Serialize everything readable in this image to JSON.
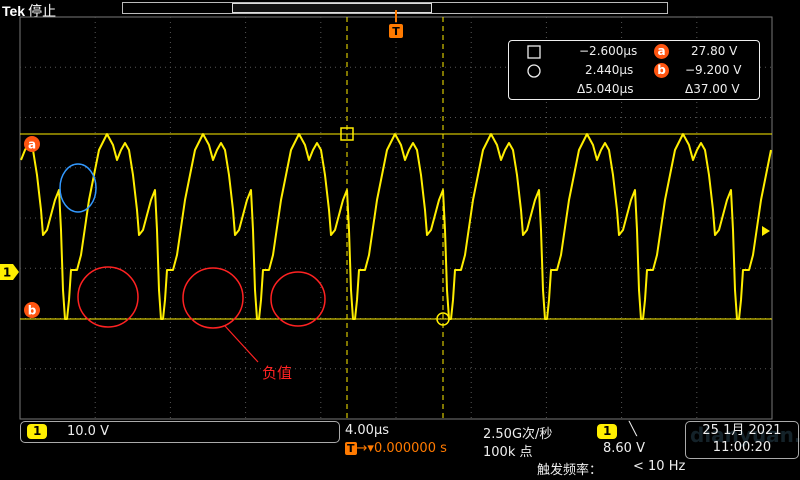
{
  "header": {
    "brand": "Tek",
    "state": "停止"
  },
  "trigger_marker": "T",
  "cursor_readout": {
    "cursor_a_time": "−2.600µs",
    "cursor_a_label": "a",
    "cursor_a_value": "27.80 V",
    "cursor_b_time": "2.440µs",
    "cursor_b_label": "b",
    "cursor_b_value": "−9.200 V",
    "delta_time": "Δ5.040µs",
    "delta_value": "Δ37.00 V"
  },
  "side_marks": {
    "cursor_a": "a",
    "cursor_b": "b",
    "channel": "1"
  },
  "annotation": {
    "text": "负值"
  },
  "channel_panel": {
    "channel": "1",
    "scale": "10.0 V"
  },
  "acquisition": {
    "timebase": "4.00µs",
    "sample_rate": "2.50G次/秒",
    "trigger_position": "0.000000 s",
    "record_length": "100k 点",
    "trigger_channel": "1",
    "trigger_slope": "╲",
    "trigger_level": "8.60 V",
    "trigger_freq_label": "触发频率：",
    "trigger_freq_value": "< 10 Hz"
  },
  "datetime": {
    "date": "25 1月 2021",
    "time": "11:00:20"
  },
  "watermark": "dianyuan.com",
  "colors": {
    "trace": "#ffee00",
    "cursor": "#ffee00",
    "trigger": "#ff7a00",
    "annotation": "#ff2222"
  }
}
